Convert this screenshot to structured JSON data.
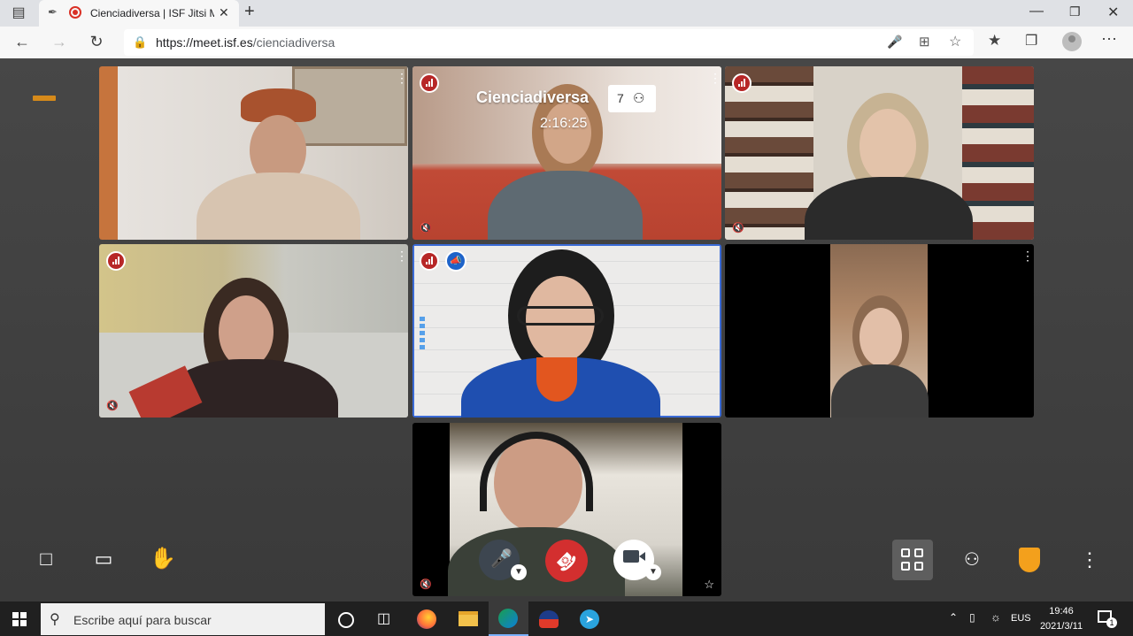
{
  "browser": {
    "tab_title": "Cienciadiversa | ISF Jitsi Mee",
    "url_host": "https://meet.isf.es",
    "url_path": "/cienciadiversa"
  },
  "meeting": {
    "name": "Cienciadiversa",
    "duration": "2:16:25",
    "participant_count": "7"
  },
  "tiles": [
    {
      "id": "tile-1",
      "signal": false,
      "muted": false
    },
    {
      "id": "tile-2",
      "signal": true,
      "muted": true
    },
    {
      "id": "tile-3",
      "signal": true,
      "muted": true
    },
    {
      "id": "tile-4",
      "signal": true,
      "muted": true
    },
    {
      "id": "tile-5",
      "signal": true,
      "muted": false,
      "active_speaker": true
    },
    {
      "id": "tile-6",
      "signal": false,
      "muted": false
    },
    {
      "id": "tile-7",
      "signal": false,
      "muted": true,
      "local": true
    }
  ],
  "toolbar": {
    "left": [
      "chat-icon",
      "screen-share-icon",
      "raise-hand-icon"
    ],
    "center": [
      "microphone-muted-icon",
      "hangup-icon",
      "camera-icon"
    ],
    "right": [
      "tile-view-icon",
      "invite-icon",
      "security-shield-icon",
      "more-icon"
    ]
  },
  "taskbar": {
    "search_placeholder": "Escribe aquí para buscar",
    "language": "EUS",
    "time": "19:46",
    "date": "2021/3/11",
    "notification_count": "1"
  },
  "colors": {
    "accent": "#3b6bd6",
    "hangup": "#d32f2f",
    "signal": "#b72727",
    "shield": "#f3a01c"
  }
}
